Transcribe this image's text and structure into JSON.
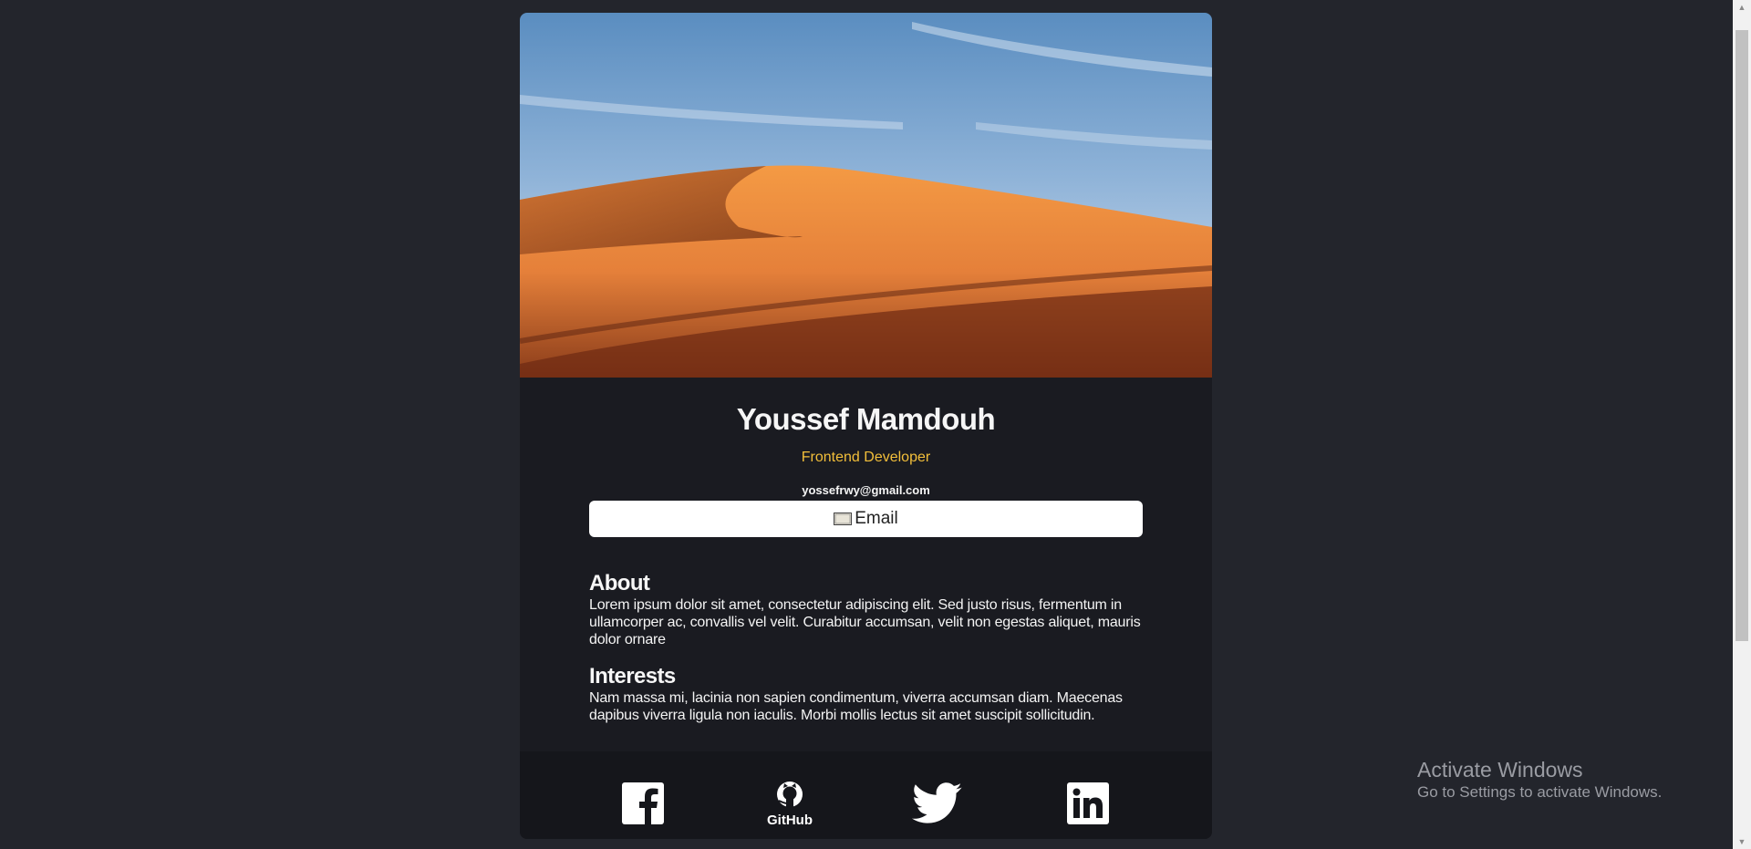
{
  "profile": {
    "name": "Youssef Mamdouh",
    "role": "Frontend Developer",
    "email": "yossefrwy@gmail.com",
    "email_button_label": "Email"
  },
  "about": {
    "heading": "About",
    "text": "Lorem ipsum dolor sit amet, consectetur adipiscing elit. Sed justo risus, fermentum in ullamcorper ac, convallis vel velit. Curabitur accumsan, velit non egestas aliquet, mauris dolor ornare"
  },
  "interests": {
    "heading": "Interests",
    "text": "Nam massa mi, lacinia non sapien condimentum, viverra accumsan diam. Maecenas dapibus viverra ligula non iaculis. Morbi mollis lectus sit amet suscipit sollicitudin."
  },
  "footer": {
    "github_label": "GitHub",
    "links": [
      "facebook",
      "github",
      "twitter",
      "linkedin"
    ]
  },
  "os_watermark": {
    "title": "Activate Windows",
    "subtitle": "Go to Settings to activate Windows."
  },
  "colors": {
    "page_bg": "#23252c",
    "card_bg": "#1a1b21",
    "footer_bg": "#15161b",
    "accent": "#f3bf3a"
  },
  "icons": {
    "email": "envelope-icon",
    "facebook": "facebook-icon",
    "github": "github-icon",
    "twitter": "twitter-icon",
    "linkedin": "linkedin-icon"
  }
}
